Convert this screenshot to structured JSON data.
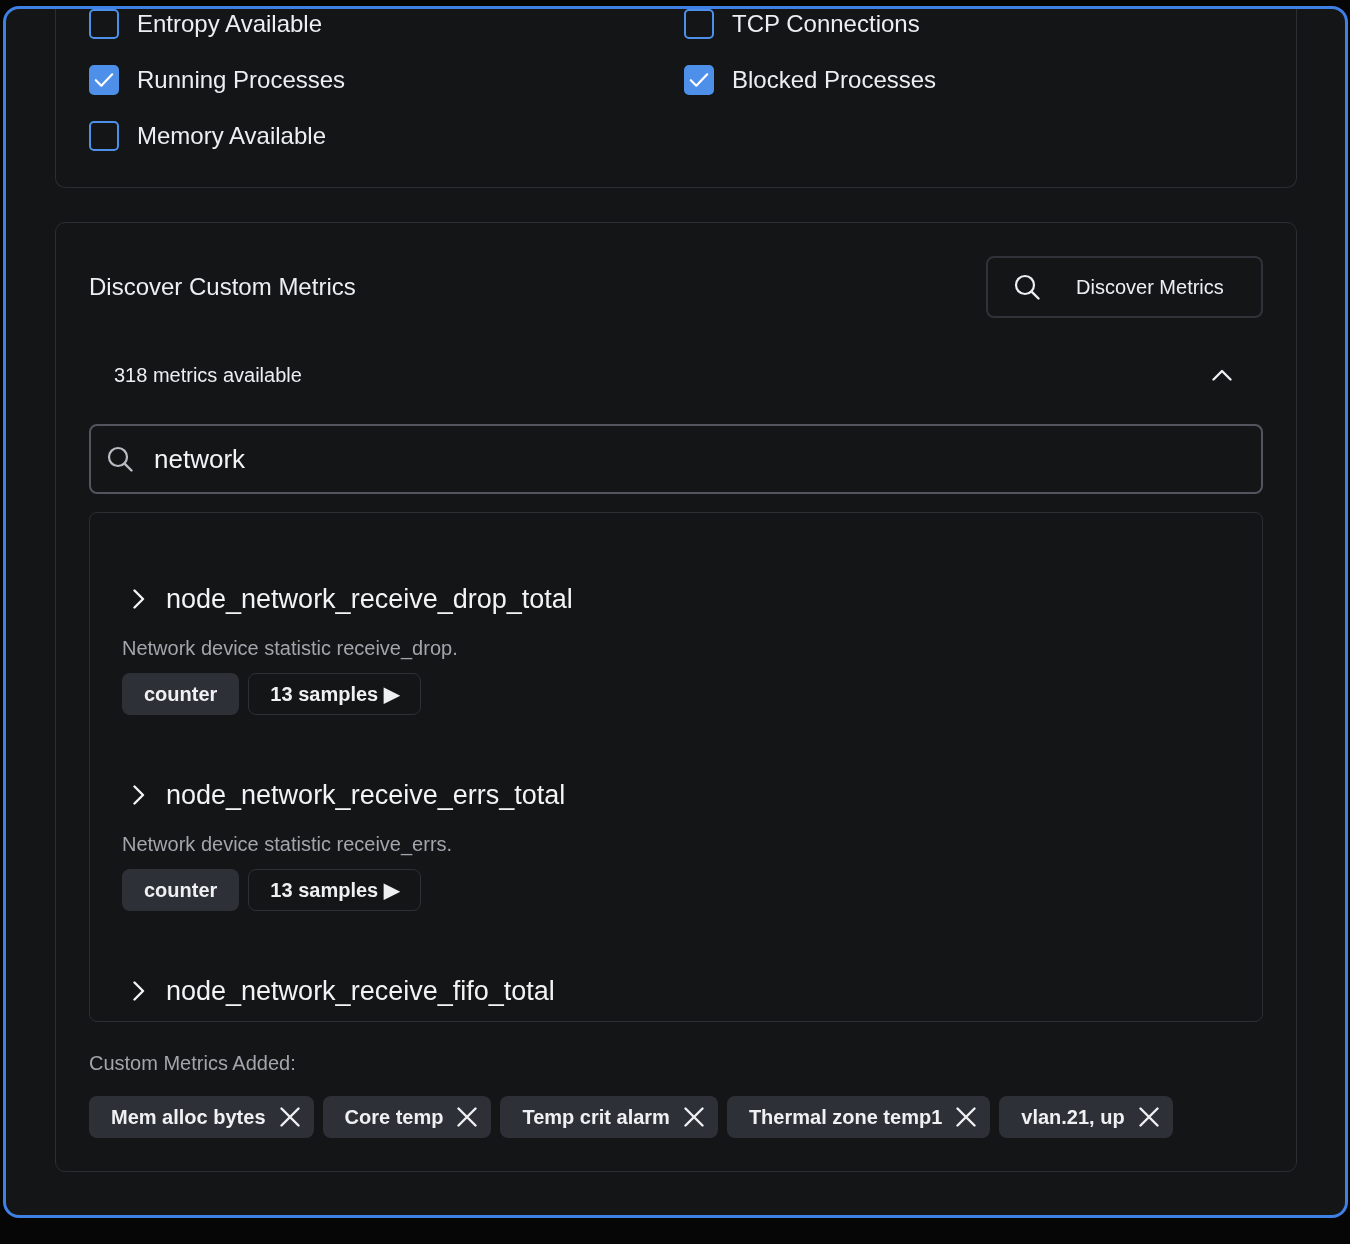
{
  "options": [
    {
      "label": "Entropy Available",
      "checked": false
    },
    {
      "label": "TCP Connections",
      "checked": false
    },
    {
      "label": "Running Processes",
      "checked": true
    },
    {
      "label": "Blocked Processes",
      "checked": true
    },
    {
      "label": "Memory Available",
      "checked": false
    }
  ],
  "discover": {
    "title": "Discover Custom Metrics",
    "button": "Discover Metrics",
    "count": "318 metrics available",
    "expanded": true,
    "search": {
      "value": "network"
    },
    "metrics": [
      {
        "name": "node_network_receive_drop_total",
        "expanded": false,
        "description": "Network device statistic receive_drop.",
        "type": "counter",
        "samples": "13 samples ▶"
      },
      {
        "name": "node_network_receive_errs_total",
        "expanded": false,
        "description": "Network device statistic receive_errs.",
        "type": "counter",
        "samples": "13 samples ▶"
      },
      {
        "name": "node_network_receive_fifo_total",
        "expanded": false
      }
    ]
  },
  "added": {
    "label": "Custom Metrics Added:",
    "chips": [
      "Mem alloc bytes",
      "Core temp",
      "Temp crit alarm",
      "Thermal zone temp1",
      "vlan.21, up"
    ]
  }
}
